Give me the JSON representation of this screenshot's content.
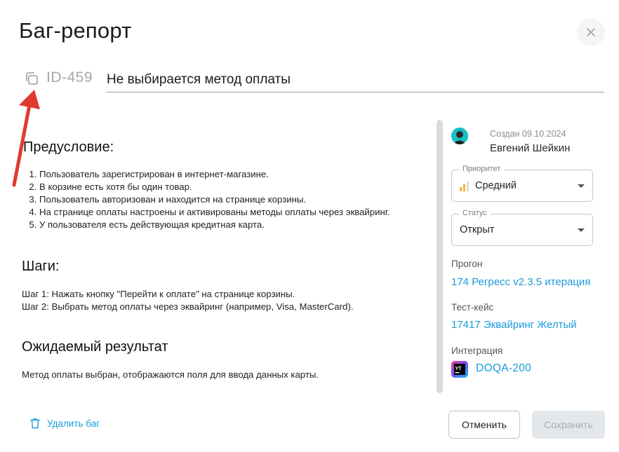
{
  "dialog": {
    "title": "Баг-репорт",
    "close_icon": "close-icon",
    "issue_id": "ID-459",
    "summary": "Не выбирается метод оплаты"
  },
  "body": {
    "precondition_title": "Предусловие:",
    "precondition_items": [
      "Пользователь зарегистрирован в интернет-магазине.",
      "В корзине есть хотя бы один товар.",
      "Пользователь авторизован и находится на странице корзины.",
      "На странице оплаты настроены и активированы методы оплаты через эквайринг.",
      "У пользователя есть действующая кредитная карта."
    ],
    "steps_title": "Шаги:",
    "steps": [
      "Шаг 1: Нажать кнопку \"Перейти к оплате\" на странице корзины.",
      "Шаг 2: Выбрать метод оплаты через эквайринг (например, Visa, MasterCard)."
    ],
    "expected_title": "Ожидаемый результат",
    "expected_text": "Метод оплаты выбран, отображаются поля для ввода данных карты."
  },
  "sidebar": {
    "created": "Создан 09.10.2024",
    "author": "Евгений Шейкин",
    "priority_label": "Приоритет",
    "priority_value": "Средний",
    "status_label": "Статус",
    "status_value": "Открыт",
    "run_label": "Прогон",
    "run_value": "174 Регресс v2.3.5 итерация",
    "testcase_label": "Тест-кейс",
    "testcase_value": "17417 Эквайринг Желтый",
    "integration_label": "Интеграция",
    "integration_value": "DOQA-200",
    "integration_icon": "youtrack-logo-icon"
  },
  "footer": {
    "delete_label": "Удалить баг",
    "cancel_label": "Отменить",
    "save_label": "Сохранить"
  },
  "colors": {
    "link": "#1a9bd8",
    "arrow": "#e03a2f",
    "priority_bars": "#f2b33d"
  }
}
